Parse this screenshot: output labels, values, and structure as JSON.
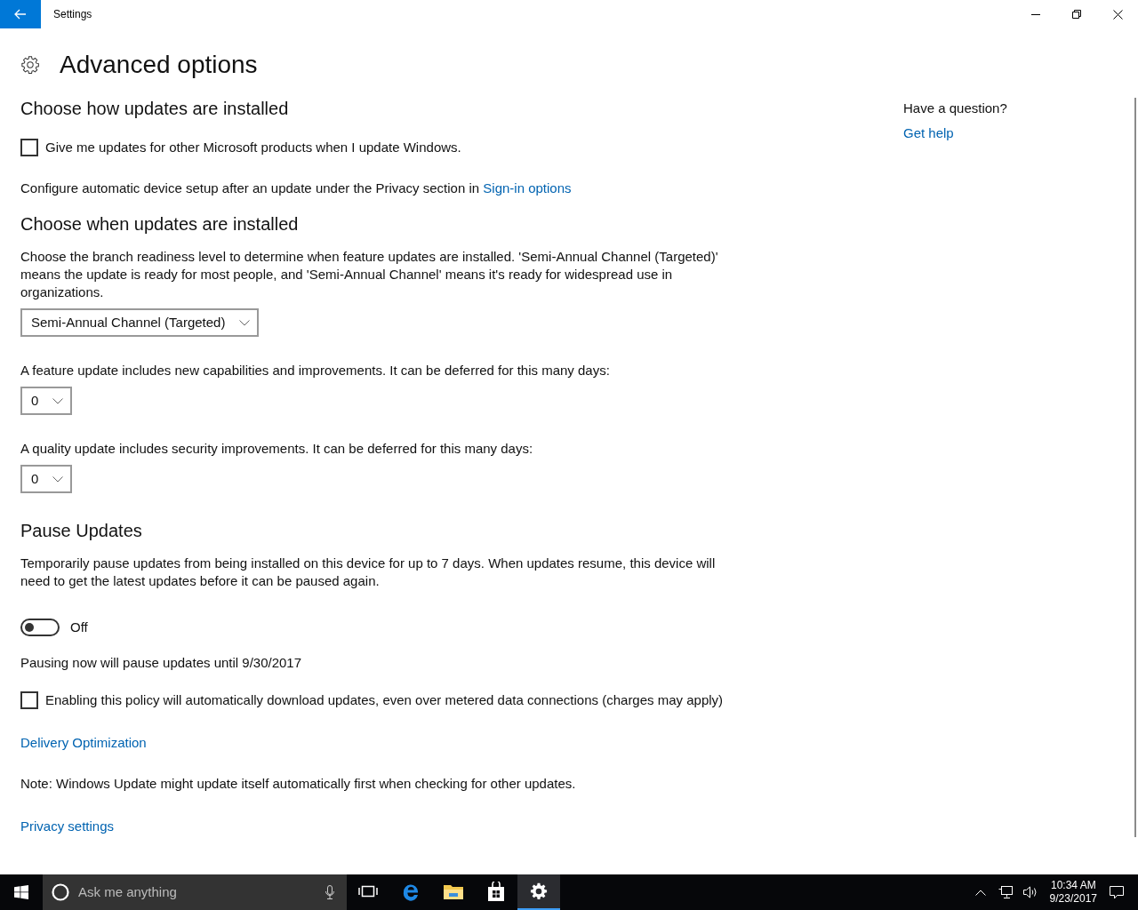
{
  "window": {
    "title": "Settings"
  },
  "page": {
    "title": "Advanced options"
  },
  "content": [
    {
      "kind": "heading",
      "text": "Choose how updates are installed"
    },
    {
      "kind": "checkbox",
      "text": "Give me updates for other Microsoft products when I update Windows.",
      "checked": false
    },
    {
      "kind": "paragraph",
      "text": "Configure automatic device setup after an update under the Privacy section in ",
      "link": "Sign-in options"
    },
    {
      "kind": "heading",
      "text": "Choose when updates are installed"
    },
    {
      "kind": "paragraph",
      "text": "Choose the branch readiness level to determine when feature updates are installed. 'Semi-Annual Channel (Targeted)' means the update is ready for most people, and 'Semi-Annual Channel' means it's ready for widespread use in organizations."
    },
    {
      "kind": "dropdown",
      "text": "Semi-Annual Channel (Targeted)"
    },
    {
      "kind": "paragraph",
      "text": "A feature update includes new capabilities and improvements. It can be deferred for this many days:"
    },
    {
      "kind": "dropdown",
      "text": "0"
    },
    {
      "kind": "paragraph",
      "text": "A quality update includes security improvements. It can be deferred for this many days:"
    },
    {
      "kind": "dropdown",
      "text": "0"
    },
    {
      "kind": "heading",
      "text": "Pause Updates"
    },
    {
      "kind": "paragraph",
      "text": "Temporarily pause updates from being installed on this device for up to 7 days. When updates resume, this device will need to get the latest updates before it can be paused again."
    },
    {
      "kind": "toggle",
      "text": "Off",
      "on": false
    },
    {
      "kind": "paragraph",
      "text": "Pausing now will pause updates until 9/30/2017"
    },
    {
      "kind": "checkbox",
      "text": "Enabling this policy will automatically download updates, even over metered data connections (charges may apply)",
      "checked": false
    },
    {
      "kind": "link",
      "text": "Delivery Optimization"
    },
    {
      "kind": "paragraph",
      "text": "Note: Windows Update might update itself automatically first when checking for other updates."
    },
    {
      "kind": "link",
      "text": "Privacy settings"
    }
  ],
  "help": {
    "question": "Have a question?",
    "link": "Get help"
  },
  "taskbar": {
    "search_placeholder": "Ask me anything",
    "apps": [
      {
        "kind": "taskview",
        "selected": false
      },
      {
        "kind": "edge",
        "selected": false
      },
      {
        "kind": "explorer",
        "selected": false
      },
      {
        "kind": "store",
        "selected": false
      },
      {
        "kind": "settings",
        "selected": true
      }
    ],
    "time": "10:34 AM",
    "date": "9/23/2017"
  }
}
